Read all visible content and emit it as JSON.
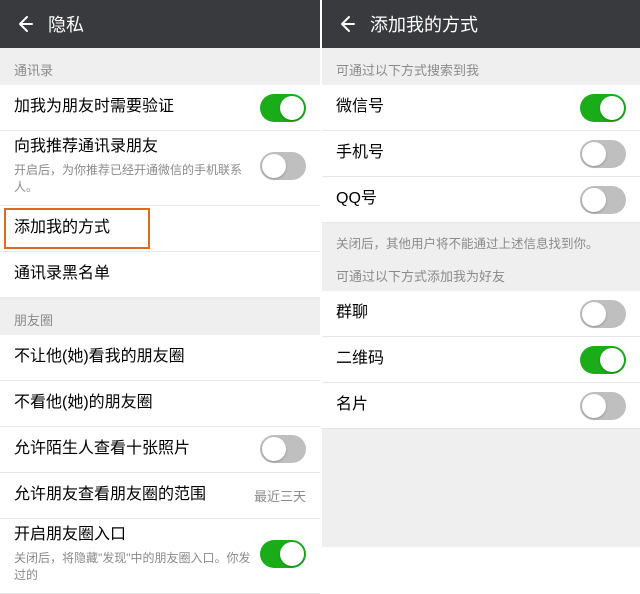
{
  "left": {
    "title": "隐私",
    "sections": {
      "contacts": {
        "header": "通讯录",
        "verify": {
          "label": "加我为朋友时需要验证",
          "on": true
        },
        "recommend": {
          "label": "向我推荐通讯录朋友",
          "sub": "开启后，为你推荐已经开通微信的手机联系人。",
          "on": false
        },
        "add_me": {
          "label": "添加我的方式"
        },
        "blacklist": {
          "label": "通讯录黑名单"
        }
      },
      "moments": {
        "header": "朋友圈",
        "block_view": {
          "label": "不让他(她)看我的朋友圈"
        },
        "hide_his": {
          "label": "不看他(她)的朋友圈"
        },
        "strangers": {
          "label": "允许陌生人查看十张照片",
          "on": false
        },
        "range": {
          "label": "允许朋友查看朋友圈的范围",
          "meta": "最近三天"
        },
        "entry": {
          "label": "开启朋友圈入口",
          "on": true,
          "sub": "关闭后，将隐藏\"发现\"中的朋友圈入口。你发过的"
        }
      }
    }
  },
  "right": {
    "title": "添加我的方式",
    "search_header": "可通过以下方式搜索到我",
    "search_items": {
      "wechat": {
        "label": "微信号",
        "on": true
      },
      "phone": {
        "label": "手机号",
        "on": false
      },
      "qq": {
        "label": "QQ号",
        "on": false
      }
    },
    "search_hint": "关闭后，其他用户将不能通过上述信息找到你。",
    "add_header": "可通过以下方式添加我为好友",
    "add_items": {
      "group": {
        "label": "群聊",
        "on": false
      },
      "qrcode": {
        "label": "二维码",
        "on": true
      },
      "card": {
        "label": "名片",
        "on": false
      }
    }
  }
}
